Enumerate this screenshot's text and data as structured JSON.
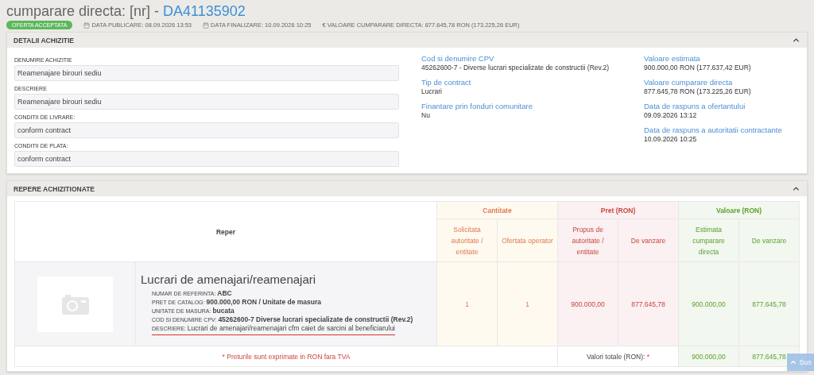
{
  "title": {
    "prefix": "cumparare directa: [nr] - ",
    "id": "DA41135902"
  },
  "status_badge": "OFERTA ACCEPTATA",
  "meta": [
    {
      "kind": "calendar",
      "text": "DATA PUBLICARE: 08.09.2026 13:53"
    },
    {
      "kind": "calendar",
      "text": "DATA FINALIZARE: 10.09.2026 10:25"
    },
    {
      "kind": "plain",
      "text": "€ VALOARE CUMPARARE DIRECTA: 877.645,78  RON (173.225,26  EUR)"
    }
  ],
  "details": {
    "title": "DETALII ACHIZITIE",
    "expanded": true,
    "fields": [
      {
        "label": "DENUMIRE ACHIZITIE",
        "value": "Reamenajare birouri sediu"
      },
      {
        "label": "DESCRIERE",
        "value": "Reamenajare birouri sediu"
      },
      {
        "label": "CONDITII DE LIVRARE:",
        "value": "conform contract"
      },
      {
        "label": "CONDITII DE PLATA:",
        "value": "conform contract"
      }
    ],
    "info_columns": [
      [
        {
          "label": "Cod si denumire CPV",
          "value": "45262600-7 - Diverse lucrari specializate de constructii (Rev.2)"
        },
        {
          "label": "Tip de contract",
          "value": "Lucrari"
        },
        {
          "label": "Finantare prin fonduri comunitare",
          "value": "Nu"
        }
      ],
      [
        {
          "label": "Valoare estimata",
          "value": "900.000,00  RON (177.637,42  EUR)"
        },
        {
          "label": "Valoare cumparare directa",
          "value": "877.645,78  RON (173.225,26  EUR)"
        },
        {
          "label": "Data de raspuns a ofertantului",
          "value": "09.09.2026 13:12"
        },
        {
          "label": "Data de raspuns a autoritatii contractante",
          "value": "10.09.2026 10:25"
        }
      ]
    ]
  },
  "items_panel": {
    "title": "REPERE ACHIZITIONATE",
    "expanded": true,
    "reper_header": "Reper",
    "groups": [
      {
        "kind": "quantity",
        "title": "Cantitate",
        "columns": [
          "Solicitata autoritate / entitate",
          "Ofertata operator"
        ]
      },
      {
        "kind": "price",
        "title": "Pret (RON)",
        "columns": [
          "Propus de autoritate / entitate",
          "De vanzare"
        ]
      },
      {
        "kind": "value",
        "title": "Valoare (RON)",
        "columns": [
          "Estimata cumparare directa",
          "De vanzare"
        ]
      }
    ],
    "rows": [
      {
        "name": "Lucrari de amenajari/reamenajari",
        "properties": [
          {
            "label": "NUMAR DE REFERINTA:",
            "value": "ABC",
            "underlined": false
          },
          {
            "label": "PRET DE CATALOG:",
            "value": "900.000,00  RON / Unitate de masura",
            "underlined": false
          },
          {
            "label": "UNITATE DE MASURA:",
            "value": "bucata",
            "underlined": false
          },
          {
            "label": "COD SI DENUMIRE CPV:",
            "value": "45262600-7 Diverse lucrari specializate de constructii (Rev.2)",
            "underlined": false
          },
          {
            "label": "DESCRIERE:",
            "value": "Lucrari de amenajari/reamenajari cfm caiet de sarcini al beneficiarului",
            "underlined": true
          }
        ],
        "cells": [
          "1",
          "1",
          "900.000,00",
          "877.645,78",
          "900.000,00",
          "877.645,78"
        ]
      }
    ],
    "note": "* Preturile sunt exprimate in RON fara TVA",
    "totals": {
      "label": "Valori totale (RON):",
      "required_mark": "*",
      "values": [
        "900.000,00",
        "877.645,78"
      ]
    }
  },
  "back_to_top": "Sus"
}
